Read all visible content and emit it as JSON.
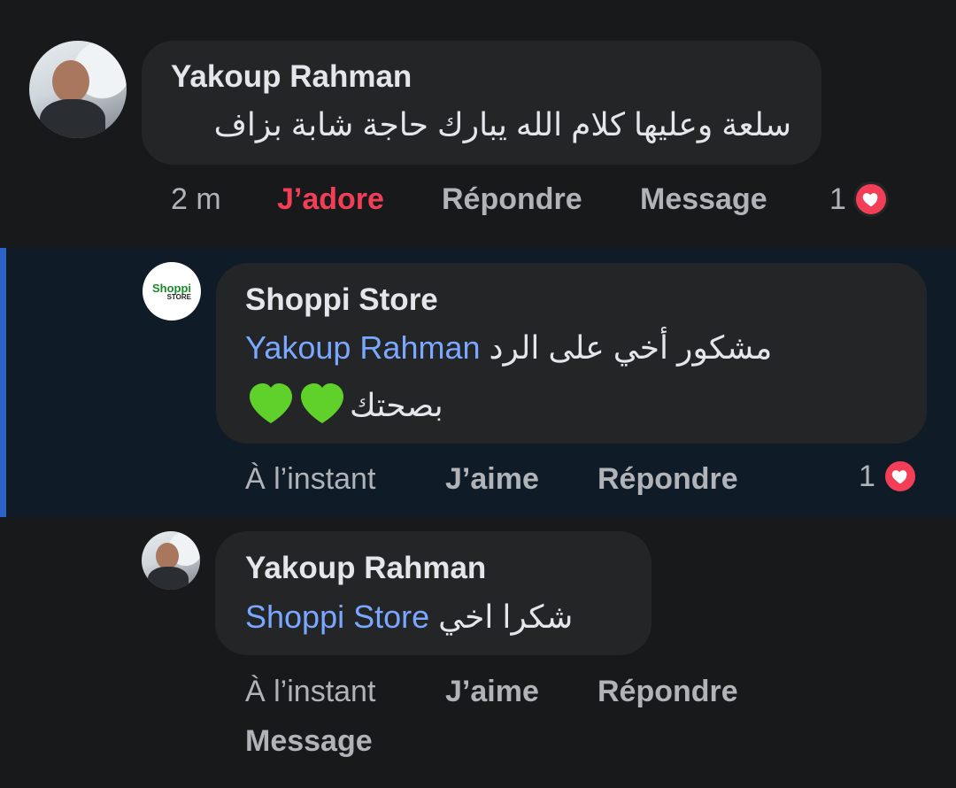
{
  "comments": [
    {
      "author": "Yakoup Rahman",
      "text": "سلعة وعليها كلام الله يبارك حاجة شابة بزاف",
      "actions": {
        "time": "2 m",
        "like": "J’adore",
        "reply": "Répondre",
        "message": "Message"
      },
      "reaction_count": "1"
    },
    {
      "author": "Shoppi Store",
      "avatar_logo": {
        "brand": "Shoppi",
        "sub": "STORE"
      },
      "mention": "Yakoup Rahman",
      "text_line1": "مشكور أخي على الرد",
      "text_line2": "بصحتك",
      "emoji": "green-heart-x2",
      "actions": {
        "time": "À l’instant",
        "like": "J’aime",
        "reply": "Répondre"
      },
      "reaction_count": "1"
    },
    {
      "author": "Yakoup Rahman",
      "mention": "Shoppi Store",
      "text": "شكرا اخي",
      "actions": {
        "time": "À l’instant",
        "like": "J’aime",
        "reply": "Répondre",
        "message": "Message"
      }
    }
  ],
  "colors": {
    "background": "#18191a",
    "bubble": "#242526",
    "mention": "#7aa7ff",
    "love": "#f33e58",
    "highlight": "#0f1b26",
    "highlight_border": "#2d63c8"
  }
}
